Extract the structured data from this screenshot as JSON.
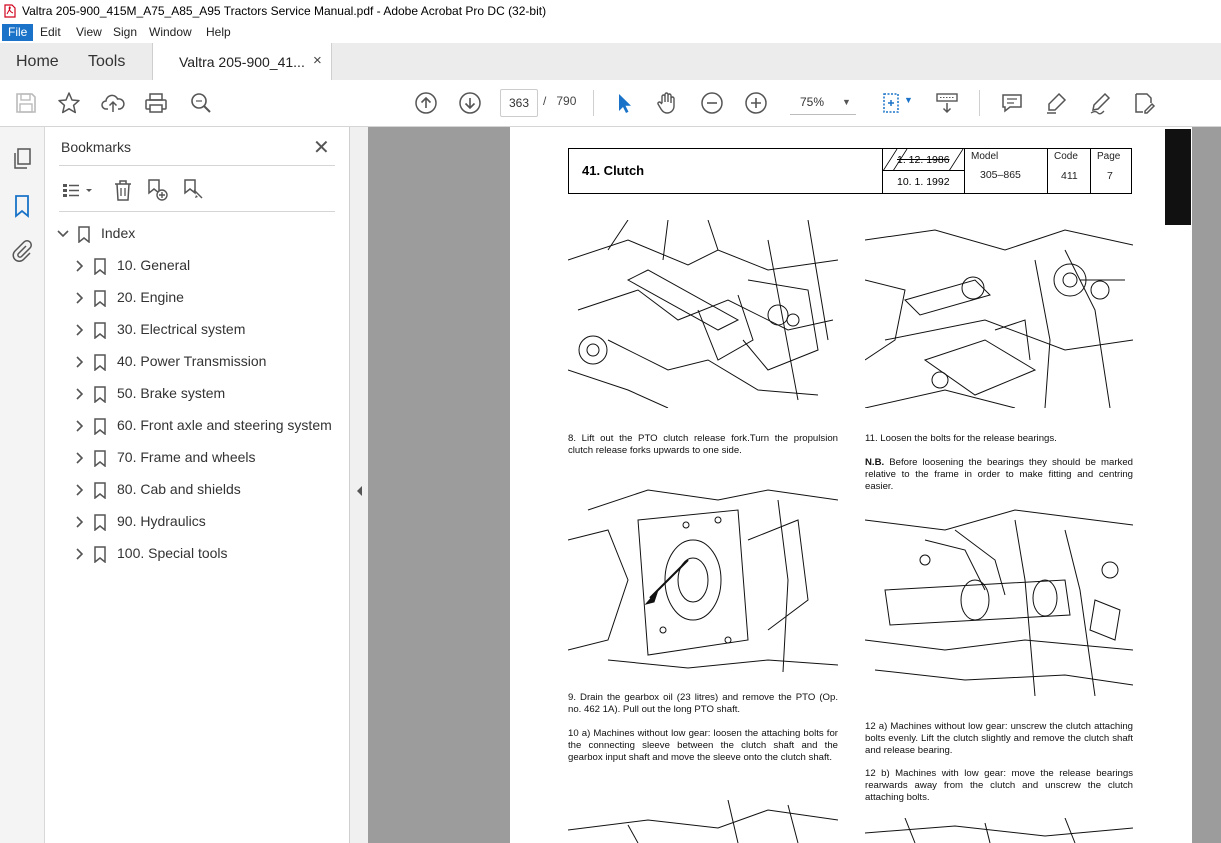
{
  "window": {
    "title": "Valtra 205-900_415M_A75_A85_A95 Tractors Service Manual.pdf - Adobe Acrobat Pro DC (32-bit)",
    "app_icon": "acrobat-icon"
  },
  "menu": {
    "items": [
      "File",
      "Edit",
      "View",
      "Sign",
      "Window",
      "Help"
    ],
    "active": "File"
  },
  "tabs": {
    "home": "Home",
    "tools": "Tools",
    "document": "Valtra 205-900_41...",
    "close_icon": "close-icon"
  },
  "toolbar": {
    "icons": [
      "save-icon",
      "bookmark-star-icon",
      "share-upload-icon",
      "print-icon",
      "find-icon",
      "page-up-icon",
      "page-down-icon",
      "select-cursor-icon",
      "hand-icon",
      "zoom-out-icon",
      "zoom-in-icon",
      "fit-page-icon",
      "scroll-mode-icon",
      "comment-icon",
      "highlight-icon",
      "sign-icon",
      "edit-pdf-icon"
    ],
    "current_page": "363",
    "page_separator": "/",
    "total_pages": "790",
    "zoom": "75%"
  },
  "sidebar": {
    "rail_icons": [
      "page-thumbnails-icon",
      "bookmarks-icon",
      "attachments-icon"
    ],
    "panel_title": "Bookmarks",
    "root": "Index",
    "items": [
      {
        "label": "10. General"
      },
      {
        "label": "20. Engine"
      },
      {
        "label": "30. Electrical system"
      },
      {
        "label": "40. Power Transmission"
      },
      {
        "label": "50. Brake system"
      },
      {
        "label": "60. Front axle and steering system"
      },
      {
        "label": "70. Frame and wheels"
      },
      {
        "label": "80. Cab and shields"
      },
      {
        "label": "90. Hydraulics"
      },
      {
        "label": "100. Special tools"
      }
    ]
  },
  "page": {
    "header": {
      "title": "41. Clutch",
      "date1": "1. 12. 1986",
      "date2": "10. 1. 1992",
      "model_label": "Model",
      "model_value": "305–865",
      "code_label": "Code",
      "code_value": "411",
      "page_label": "Page",
      "page_value": "7"
    },
    "captions": {
      "c8": "8. Lift out the PTO clutch release fork.Turn the propulsion clutch release forks upwards to one side.",
      "c11": "11. Loosen the bolts for the release bearings.",
      "nb_label": "N.B.",
      "nb_text": "Before loosening the bearings they should be marked relative to the frame in order to make fitting and centring easier.",
      "c9": "9. Drain the gearbox oil (23 litres) and remove the PTO (Op. no. 462 1A). Pull out the long PTO shaft.",
      "c10a": "10 a) Machines without low gear: loosen the attaching bolts for the connecting sleeve between the clutch shaft and the gearbox input shaft and move the sleeve onto the clutch shaft.",
      "c12a": "12 a) Machines without low gear: unscrew the clutch attaching bolts evenly. Lift the clutch slightly and remove the clutch shaft and release bearing.",
      "c12b": "12 b) Machines with low gear: move the release bearings rearwards away from the clutch and unscrew the clutch attaching bolts."
    }
  }
}
